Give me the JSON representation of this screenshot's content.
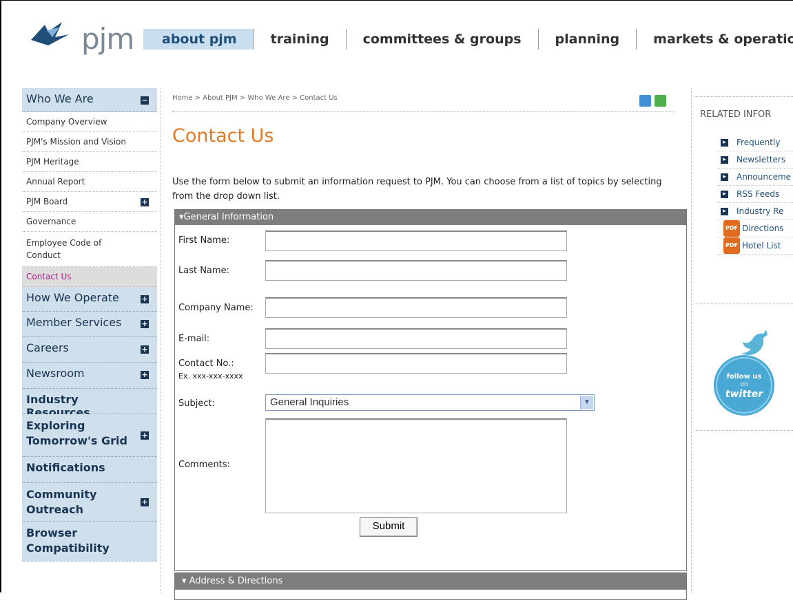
{
  "logo": {
    "text": "pjm"
  },
  "topnav": [
    {
      "label": "about pjm",
      "active": true
    },
    {
      "label": "training"
    },
    {
      "label": "committees & groups"
    },
    {
      "label": "planning"
    },
    {
      "label": "markets & operation"
    }
  ],
  "sidebar": {
    "who_we_are": "Who We Are",
    "sub": [
      "Company Overview",
      "PJM's Mission and Vision",
      "PJM Heritage",
      "Annual Report",
      "PJM Board",
      "Governance",
      "Employee Code of Conduct",
      "Contact Us"
    ],
    "sections": [
      "How We Operate",
      "Member Services",
      "Careers",
      "Newsroom",
      "Industry Resources",
      "Exploring Tomorrow's Grid",
      "Notifications",
      "Community Outreach",
      "Browser Compatibility"
    ]
  },
  "breadcrumb": "Home > About PJM > Who We Are > Contact Us",
  "page": {
    "title": "Contact Us",
    "intro": "Use the form below to submit an information request to PJM. You can choose from a list of topics by selecting from the drop down list."
  },
  "form": {
    "section_title": "General Information",
    "first_name": "First Name:",
    "last_name": "Last Name:",
    "company": "Company Name:",
    "email": "E-mail:",
    "contact": "Contact No.:",
    "contact_hint": "Ex. xxx-xxx-xxxx",
    "subject": "Subject:",
    "subject_value": "General Inquiries",
    "comments": "Comments:",
    "submit": "Submit"
  },
  "address_section": "Address & Directions",
  "related": {
    "title": "RELATED INFOR",
    "items": [
      {
        "type": "link",
        "label": "Frequently"
      },
      {
        "type": "link",
        "label": "Newsletters"
      },
      {
        "type": "link",
        "label": "Announceme"
      },
      {
        "type": "link",
        "label": "RSS Feeds"
      },
      {
        "type": "link",
        "label": "Industry Re"
      },
      {
        "type": "pdf",
        "label": "Directions"
      },
      {
        "type": "pdf",
        "label": "Hotel List"
      }
    ],
    "pdf_badge": "PDF"
  },
  "twitter": {
    "line1": "follow us",
    "line2": "on",
    "line3": "twitter"
  },
  "colors": {
    "accent_orange": "#e07b28",
    "nav_active_bg": "#c9dfef",
    "sidebar_bg": "#cfe0ec",
    "panel_head": "#7d7d7d"
  }
}
